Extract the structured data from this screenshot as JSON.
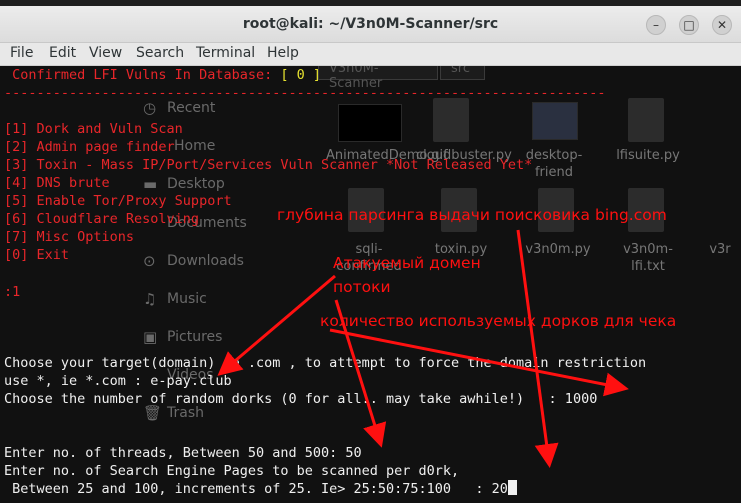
{
  "window": {
    "title": "root@kali: ~/V3n0M-Scanner/src",
    "buttons": {
      "minimize": "–",
      "maximize": "□",
      "close": "✕"
    }
  },
  "menu": [
    "File",
    "Edit",
    "View",
    "Search",
    "Terminal",
    "Help"
  ],
  "background_file_manager": {
    "tabs": [
      "V3n0M-Scanner",
      "src"
    ],
    "sidebar": [
      "Recent",
      "Home",
      "Desktop",
      "Documents",
      "Downloads",
      "Music",
      "Pictures",
      "Videos",
      "Trash"
    ],
    "files": [
      "AnimatedDemo.gif",
      "cloudbuster.py",
      "desktop-friend",
      "lfisuite.py",
      "sqli-confirmed",
      "toxin.py",
      "v3n0m.py",
      "v3n0m-lfi.txt",
      "v3r"
    ]
  },
  "terminal": {
    "confirmed_prefix": " Confirmed LFI Vulns In Database: ",
    "confirmed_value": "[ 0 ]",
    "separator": "--------------------------------------------------------------------------",
    "menu_items": [
      "[1] Dork and Vuln Scan",
      "[2] Admin page finder",
      "[3] Toxin - Mass IP/Port/Services Vuln Scanner *Not Released Yet*",
      "[4] DNS brute",
      "[5] Enable Tor/Proxy Support",
      "[6] Cloudflare Resolving",
      "[7] Misc Options",
      "[0] Exit"
    ],
    "prompt": ":1",
    "lines": [
      "Choose your target(domain) ie .com , to attempt to force the domain restriction",
      "use *, ie *.com : e-pay.club",
      "Choose the number of random dorks (0 for all.. may take awhile!)   : 1000",
      "",
      "",
      "Enter no. of threads, Between 50 and 500: 50",
      "Enter no. of Search Engine Pages to be scanned per d0rk,",
      " Between 25 and 100, increments of 25. Ie> 25:50:75:100   : 20"
    ]
  },
  "annotations": {
    "depth": "глубина парсинга выдачи поисковика bing.com",
    "domain": "Атакуемый домен",
    "threads": "потоки",
    "dorks": "количество используемых дорков для чека"
  },
  "colors": {
    "accent_red": "#e8262a",
    "annotation_red": "#ff1010",
    "highlight_yellow": "#e6e230",
    "terminal_bg": "#111111"
  }
}
